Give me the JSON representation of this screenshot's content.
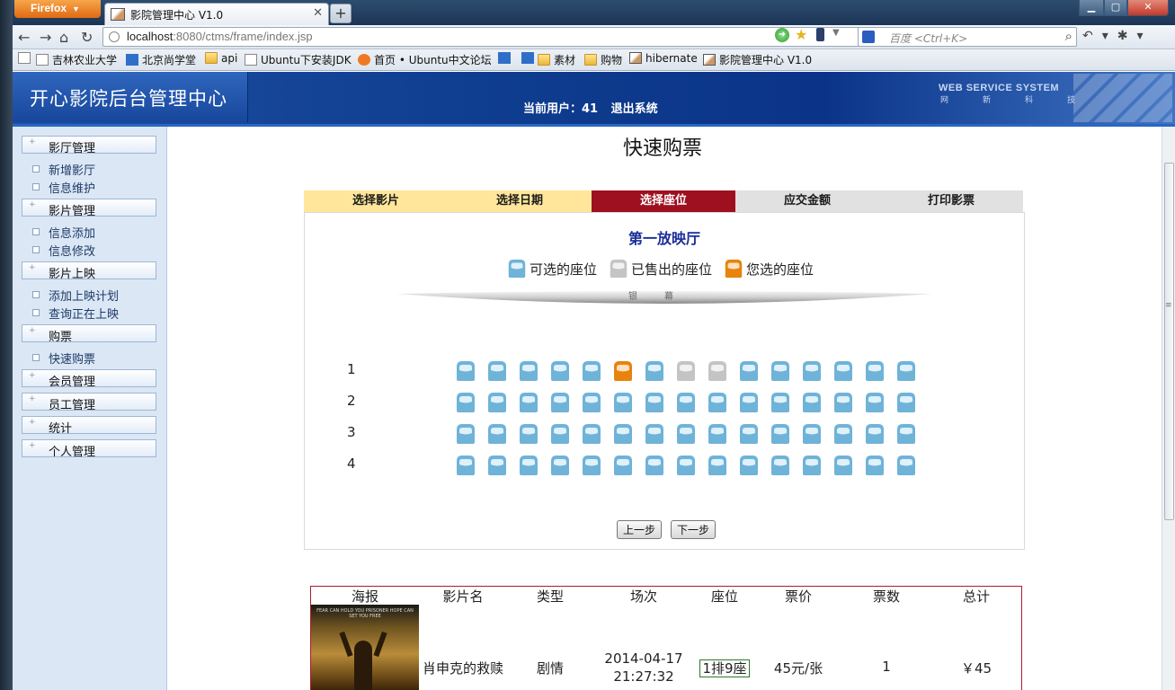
{
  "browser": {
    "menu_label": "Firefox",
    "tab_title": "影院管理中心 V1.0",
    "url_host": "localhost",
    "url_rest": ":8080/ctms/frame/index.jsp",
    "search_placeholder": "百度 <Ctrl+K>",
    "bookmarks": [
      "吉林农业大学",
      "北京尚学堂",
      "api",
      "Ubuntu下安装JDK",
      "首页 • Ubuntu中文论坛",
      "素材",
      "购物",
      "hibernate",
      "影院管理中心 V1.0"
    ]
  },
  "header": {
    "title": "开心影院后台管理中心",
    "current_user_label": "当前用户：41",
    "logout_label": "退出系统",
    "brand": "WEB SERVICE SYSTEM",
    "brand_sub": "网新科技"
  },
  "sidebar": {
    "groups": [
      {
        "label": "影厅管理",
        "items": [
          "新增影厅",
          "信息维护"
        ]
      },
      {
        "label": "影片管理",
        "items": [
          "信息添加",
          "信息修改"
        ]
      },
      {
        "label": "影片上映",
        "items": [
          "添加上映计划",
          "查询正在上映"
        ]
      },
      {
        "label": "购票",
        "items": [
          "快速购票"
        ]
      },
      {
        "label": "会员管理",
        "items": []
      },
      {
        "label": "员工管理",
        "items": []
      },
      {
        "label": "统计",
        "items": []
      },
      {
        "label": "个人管理",
        "items": []
      }
    ]
  },
  "page": {
    "title": "快速购票",
    "steps": [
      {
        "label": "选择影片",
        "state": "done"
      },
      {
        "label": "选择日期",
        "state": "done"
      },
      {
        "label": "选择座位",
        "state": "active"
      },
      {
        "label": "应交金额",
        "state": "todo"
      },
      {
        "label": "打印影票",
        "state": "todo"
      }
    ],
    "hall_name": "第一放映厅",
    "legend": {
      "available": "可选的座位",
      "sold": "已售出的座位",
      "selected": "您选的座位"
    },
    "screen_label": "银幕",
    "seat_colors": {
      "available": "#6fb3d8",
      "sold": "#c4c4c4",
      "selected": "#e8830e"
    },
    "rows": [
      {
        "num": "1",
        "seats": [
          "a",
          "a",
          "a",
          "a",
          "a",
          "s",
          "a",
          "x",
          "x",
          "a",
          "a",
          "a",
          "a",
          "a",
          "a"
        ]
      },
      {
        "num": "2",
        "seats": [
          "a",
          "a",
          "a",
          "a",
          "a",
          "a",
          "a",
          "a",
          "a",
          "a",
          "a",
          "a",
          "a",
          "a",
          "a"
        ]
      },
      {
        "num": "3",
        "seats": [
          "a",
          "a",
          "a",
          "a",
          "a",
          "a",
          "a",
          "a",
          "a",
          "a",
          "a",
          "a",
          "a",
          "a",
          "a"
        ]
      },
      {
        "num": "4",
        "seats": [
          "a",
          "a",
          "a",
          "a",
          "a",
          "a",
          "a",
          "a",
          "a",
          "a",
          "a",
          "a",
          "a",
          "a",
          "a"
        ]
      }
    ],
    "prev_label": "上一步",
    "next_label": "下一步"
  },
  "order": {
    "headers": [
      "海报",
      "影片名",
      "类型",
      "场次",
      "座位",
      "票价",
      "票数",
      "总计"
    ],
    "movie_name": "肖申克的救赎",
    "genre": "剧情",
    "show_date": "2014-04-17",
    "show_time": "21:27:32",
    "seat": "1排9座",
    "price": "45元/张",
    "count": "1",
    "total": "￥45",
    "poster_tagline": "FEAR CAN HOLD YOU PRISONER HOPE CAN SET YOU FREE"
  }
}
